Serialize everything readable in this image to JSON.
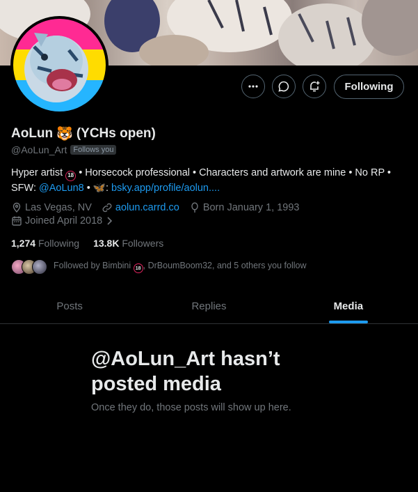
{
  "profile": {
    "display_name": "AoLun",
    "name_emoji": "🐯",
    "name_suffix": "(YCHs open)",
    "handle": "@AoLun_Art",
    "follows_you": "Follows you",
    "bio": {
      "part1": "Hyper artist",
      "badge": "18",
      "part2": " • Horsecock professional • Characters and artwork are mine • No RP • SFW: ",
      "link1": "@AoLun8",
      "sep": " • ",
      "butterfly": "🦋",
      "colon": ": ",
      "link2": "bsky.app/profile/aolun...."
    },
    "location": "Las Vegas, NV",
    "website": "aolun.carrd.co",
    "born": "Born January 1, 1993",
    "joined": "Joined April 2018",
    "following_count": "1,274",
    "following_label": "Following",
    "followers_count": "13.8K",
    "followers_label": "Followers",
    "followed_by": {
      "prefix": "Followed by Bimbini",
      "badge": "18",
      "suffix": ", DrBoumBoom32, and 5 others you follow"
    }
  },
  "actions": {
    "more_icon": "more-icon",
    "message_icon": "message-icon",
    "notify_icon": "bell-plus-icon",
    "follow_label": "Following"
  },
  "tabs": [
    {
      "label": "Posts"
    },
    {
      "label": "Replies"
    },
    {
      "label": "Media"
    }
  ],
  "empty_state": {
    "title": "@AoLun_Art hasn’t posted media",
    "subtitle": "Once they do, those posts will show up here."
  },
  "colors": {
    "accent": "#1d9bf0",
    "background": "#000000",
    "text": "#e7e9ea",
    "muted": "#71767b"
  }
}
